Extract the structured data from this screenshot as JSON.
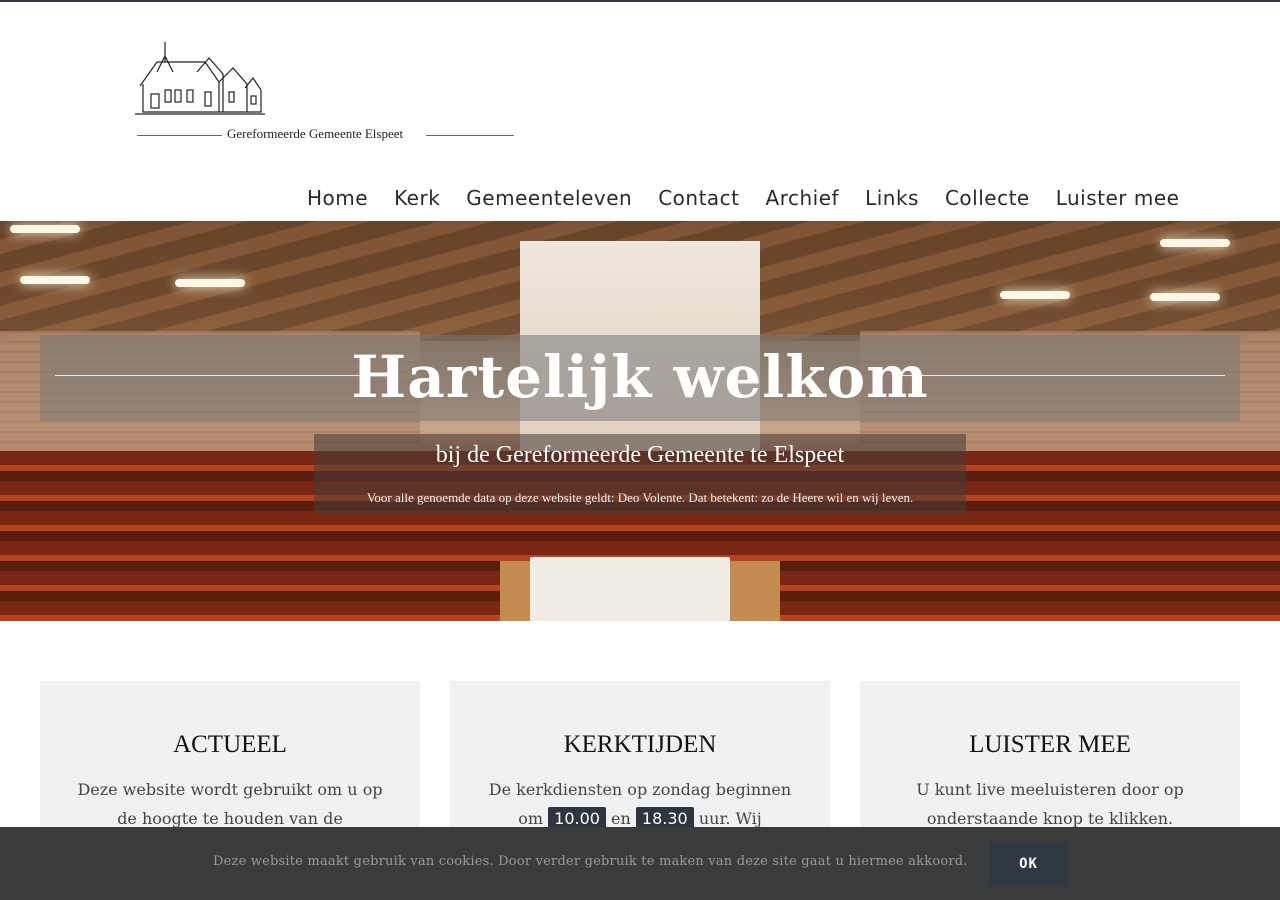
{
  "logo": {
    "text": "Gereformeerde Gemeente Elspeet",
    "icon": "church-drawing-icon"
  },
  "nav": {
    "items": [
      {
        "label": "Home"
      },
      {
        "label": "Kerk"
      },
      {
        "label": "Gemeenteleven"
      },
      {
        "label": "Contact"
      },
      {
        "label": "Archief"
      },
      {
        "label": "Links"
      },
      {
        "label": "Collecte"
      },
      {
        "label": "Luister mee"
      }
    ]
  },
  "hero": {
    "title": "Hartelijk welkom",
    "subtitle": "bij de Gereformeerde Gemeente te Elspeet",
    "note": "Voor alle genoemde data op deze website geldt: Deo Volente. Dat betekent: zo de Heere wil en wij leven."
  },
  "cards": [
    {
      "title": "ACTUEEL",
      "text": "Deze website wordt gebruikt om u op de hoogte te houden van de"
    },
    {
      "title": "KERKTIJDEN",
      "text_before": "De kerkdiensten op zondag beginnen om",
      "time1": "10.00",
      "text_mid": "en",
      "time2": "18.30",
      "text_after": "uur. Wij"
    },
    {
      "title": "LUISTER MEE",
      "text": "U kunt live meeluisteren door op onderstaande knop te klikken."
    }
  ],
  "cookie": {
    "text": "Deze website maakt gebruik van cookies. Door verder gebruik te maken van deze site gaat u hiermee akkoord.",
    "button": "OK"
  },
  "colors": {
    "dark": "#3a3b3d",
    "badge": "#2e3540",
    "card_bg": "#f0f1f3"
  }
}
